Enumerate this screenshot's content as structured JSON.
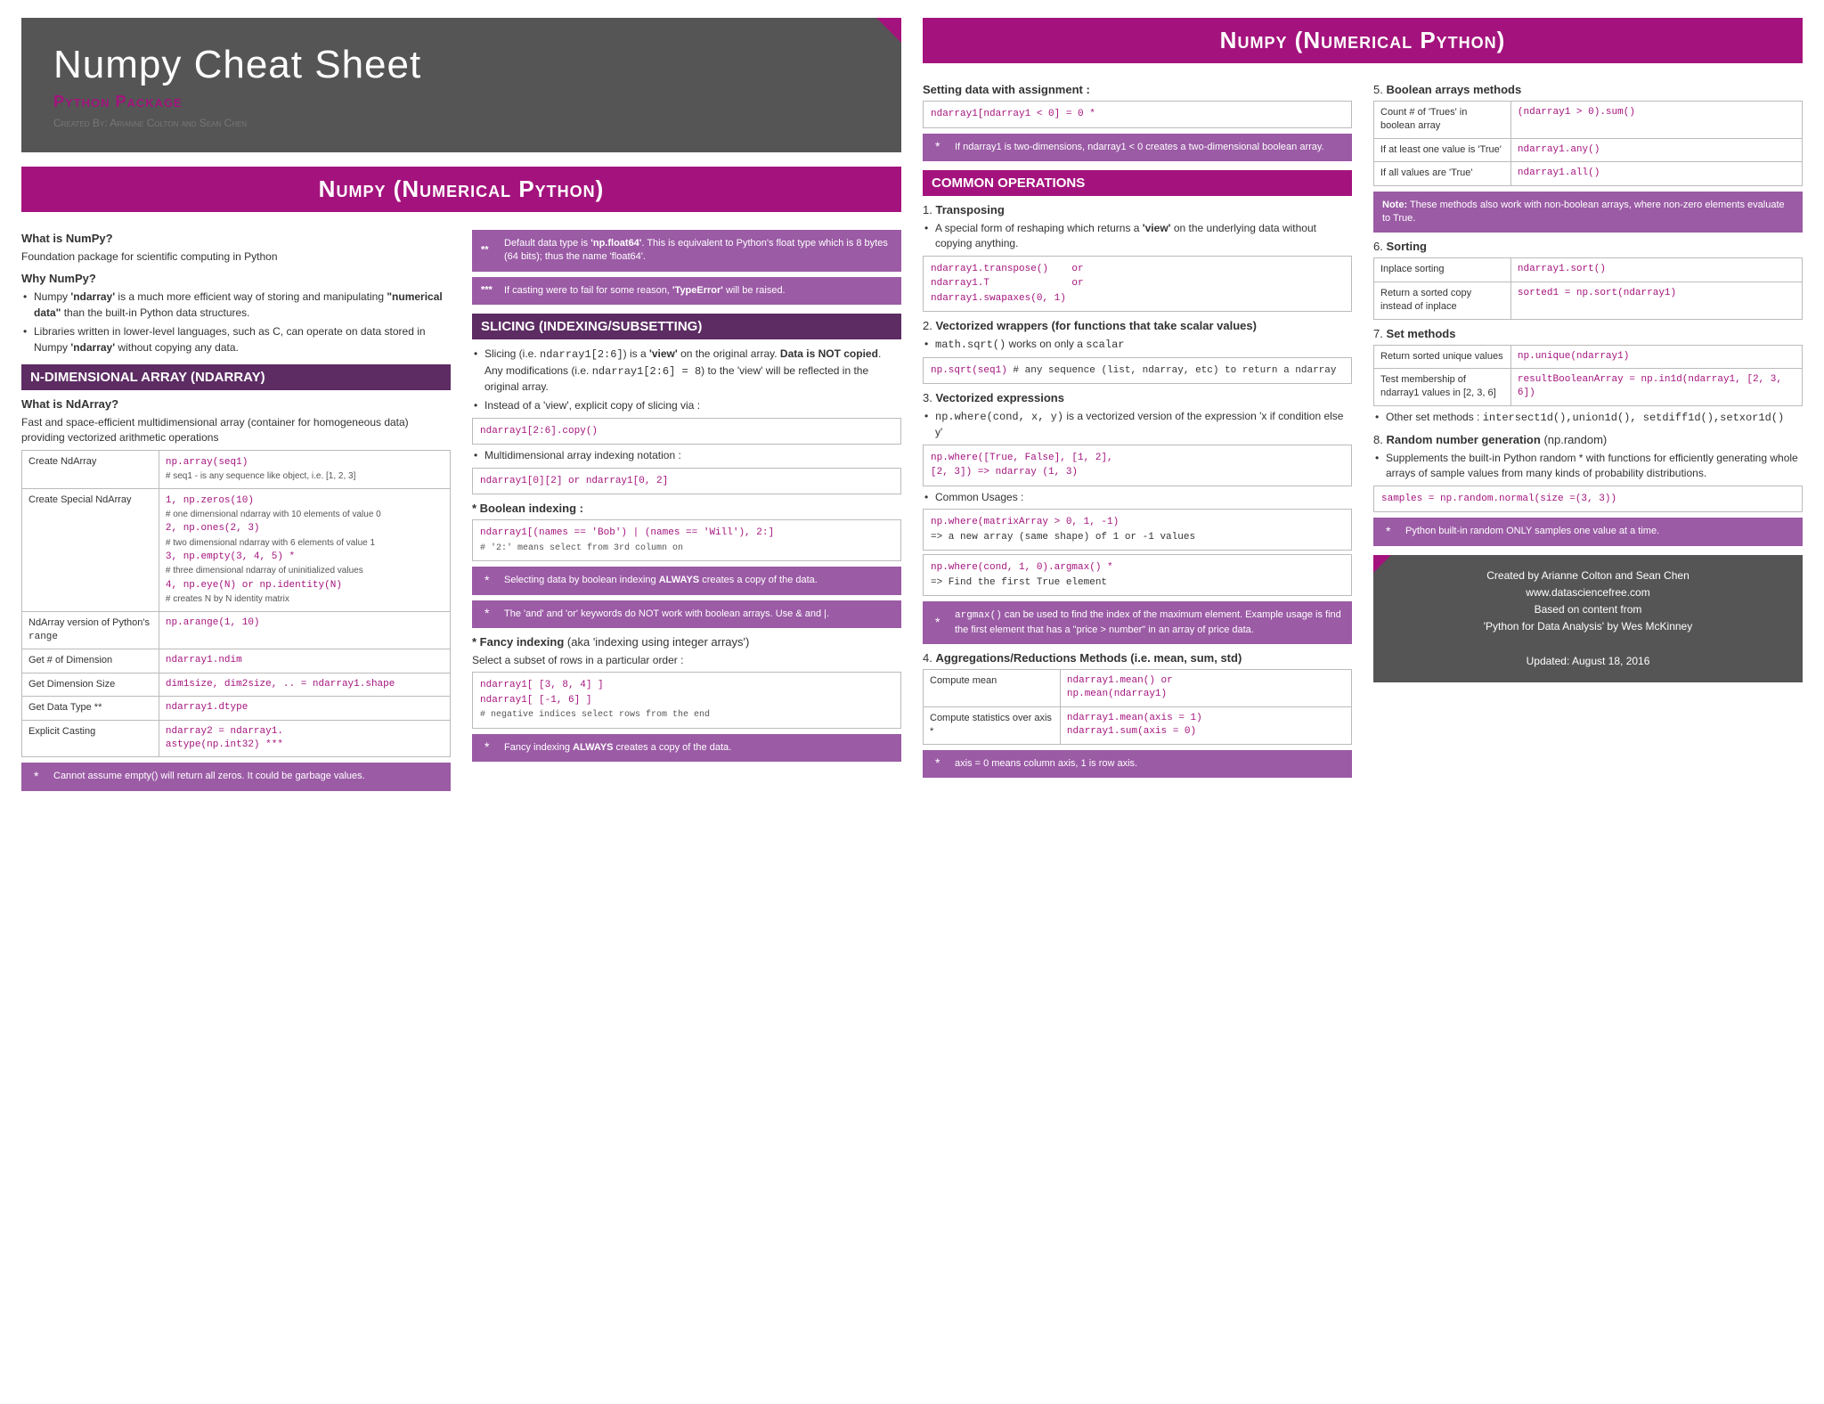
{
  "title": "Numpy Cheat Sheet",
  "subtitle": "Python Package",
  "credit": "Created By: Arianne Colton and Sean Chen",
  "banner_left": "Numpy (Numerical Python)",
  "banner_right": "Numpy (Numerical Python)",
  "c1": {
    "h_what": "What is NumPy?",
    "p_what": "Foundation package for scientific computing in Python",
    "h_why": "Why NumPy?",
    "why1_a": "Numpy ",
    "why1_b": "'ndarray'",
    "why1_c": " is a much more efficient way of storing and manipulating ",
    "why1_d": "\"numerical data\"",
    "why1_e": " than the built-in Python data structures.",
    "why2_a": "Libraries written in lower-level languages, such as C, can operate on data stored in Numpy ",
    "why2_b": "'ndarray'",
    "why2_c": " without copying any data.",
    "sub_nd": "N-DIMENSIONAL ARRAY (NDARRAY)",
    "h_nd": "What is NdArray?",
    "p_nd": "Fast and space-efficient multidimensional array (container for homogeneous data) providing vectorized arithmetic operations",
    "r1l": "Create NdArray",
    "r1c": "np.array(seq1)",
    "r1n": "# seq1 - is any sequence like object, i.e. [1, 2, 3]",
    "r2l": "Create Special NdArray",
    "r2a": "1, np.zeros(10)",
    "r2an": "# one dimensional ndarray with 10 elements of value 0",
    "r2b": "2, np.ones(2, 3)",
    "r2bn": "# two dimensional ndarray with 6 elements of value 1",
    "r2c": "3, np.empty(3, 4, 5) *",
    "r2cn": "# three dimensional ndarray of uninitialized values",
    "r2d": "4, np.eye(N) or np.identity(N)",
    "r2dn": "# creates N by N identity matrix",
    "r3l": "NdArray version of Python's ",
    "r3l2": "range",
    "r3c": "np.arange(1, 10)",
    "r4l": "Get # of Dimension",
    "r4c": "ndarray1.ndim",
    "r5l": "Get Dimension Size",
    "r5c": "dim1size, dim2size, .. = ndarray1.shape",
    "r6l": "Get Data Type **",
    "r6c": "ndarray1.dtype",
    "r7l": "Explicit Casting",
    "r7c": "ndarray2 = ndarray1.\nastype(np.int32) ***",
    "tip1": "Cannot assume empty() will return all zeros. It could be garbage values."
  },
  "c2": {
    "tip_a": "Default data type is ",
    "tip_ab": "'np.float64'",
    "tip_ac": ". This is equivalent to Python's float type which is 8 bytes (64 bits); thus the name 'float64'.",
    "tip_b": "If casting were to fail for some reason, ",
    "tip_bb": "'TypeError'",
    "tip_bc": " will be raised.",
    "sub": "SLICING (INDEXING/SUBSETTING)",
    "s1a": "Slicing (i.e. ",
    "s1b": "ndarray1[2:6]",
    "s1c": ") is a ",
    "s1d": "'view'",
    "s1e": " on the original array. ",
    "s1f": "Data is NOT copied",
    "s1g": ". Any modifications (i.e. ",
    "s1h": "ndarray1[2:6] = 8",
    "s1i": ") to the 'view' will be reflected in the original array.",
    "s2": "Instead of a 'view', explicit copy of slicing via :",
    "cb1": "ndarray1[2:6].copy()",
    "s3": "Multidimensional array indexing notation :",
    "cb2": "ndarray1[0][2] or ndarray1[0, 2]",
    "h_bool": "* Boolean indexing :",
    "cb3": "ndarray1[(names == 'Bob') | (names == 'Will'), 2:]",
    "cb3n": "# '2:' means select from 3rd column on",
    "tip_c1": "Selecting data by boolean indexing ",
    "tip_c2": "ALWAYS",
    "tip_c3": " creates a copy of the data.",
    "tip_d": "The 'and' and 'or' keywords do NOT work with boolean arrays. Use & and |.",
    "h_fancy": "* Fancy indexing",
    "h_fancy2": " (aka 'indexing using integer arrays')",
    "p_fancy": "Select a subset of rows in a particular order :",
    "cb4a": "ndarray1[ [3, 8, 4] ]",
    "cb4b": "ndarray1[ [-1, 6] ]",
    "cb4n": "# negative indices select rows from the end",
    "tip_e1": "Fancy indexing ",
    "tip_e2": "ALWAYS",
    "tip_e3": " creates a copy of the data."
  },
  "c3": {
    "h_set": "Setting data with assignment :",
    "cb1": "ndarray1[ndarray1 < 0] = 0 *",
    "tip1": "If ndarray1 is two-dimensions, ndarray1 < 0 creates a two-dimensional boolean array.",
    "sub": "COMMON OPERATIONS",
    "n1": "1.",
    "t1": "Transposing",
    "p1a": "A special form of reshaping which returns a ",
    "p1b": "'view'",
    "p1c": " on the underlying data without copying anything.",
    "cb_t": "ndarray1.transpose()    or\nndarray1.T              or\nndarray1.swapaxes(0, 1)",
    "n2": "2.",
    "t2": "Vectorized wrappers (for functions that take scalar values)",
    "p2a": "math.sqrt()",
    "p2b": " works on only a ",
    "p2c": "scalar",
    "cb2a": "np.sqrt(seq1)",
    "cb2b": " # any sequence (list, ndarray, etc) to return a ndarray",
    "n3": "3.",
    "t3": "Vectorized expressions",
    "p3a": "np.where(cond, x, y)",
    "p3b": " is a vectorized version of the expression 'x if condition else y'",
    "cb3": "np.where([True, False], [1, 2],\n[2, 3]) => ndarray (1, 3)",
    "p_cu": "Common Usages :",
    "cb4a": "np.where(matrixArray > 0, 1, -1)",
    "cb4an": "=> a new array (same shape) of 1 or -1 values",
    "cb4b": "np.where(cond, 1, 0).argmax() *",
    "cb4bn": "=> Find the first True element",
    "tip_arg1": "argmax()",
    "tip_arg2": " can be used to find the index of the maximum element. Example usage is find the first element that has a \"price > number\" in an array of price data.",
    "n4": "4.",
    "t4": "Aggregations/Reductions Methods (i.e. mean, sum, std)",
    "r1l": "Compute mean",
    "r1c": "ndarray1.mean()   or\nnp.mean(ndarray1)",
    "r2l": "Compute statistics over axis *",
    "r2c": "ndarray1.mean(axis = 1)\nndarray1.sum(axis = 0)",
    "tip_ax": "axis = 0 means column axis, 1 is row axis."
  },
  "c4": {
    "n5": "5.",
    "t5": "Boolean arrays methods",
    "r1l": "Count # of 'Trues' in boolean array",
    "r1c": "(ndarray1 > 0).sum()",
    "r2l": "If at least one value is 'True'",
    "r2c": "ndarray1.any()",
    "r3l": "If all values are 'True'",
    "r3c": "ndarray1.all()",
    "note5a": "Note:",
    "note5b": " These methods also work with non-boolean arrays, where non-zero elements evaluate to True.",
    "n6": "6.",
    "t6": "Sorting",
    "s1l": "Inplace sorting",
    "s1c": "ndarray1.sort()",
    "s2l": "Return a sorted copy instead of inplace",
    "s2c": "sorted1 = np.sort(ndarray1)",
    "n7": "7.",
    "t7": "Set methods",
    "m1l": "Return sorted unique values",
    "m1c": "np.unique(ndarray1)",
    "m2l": "Test membership of ndarray1 values in [2, 3, 6]",
    "m2c": "resultBooleanArray = np.in1d(ndarray1, [2, 3, 6])",
    "other": "Other set methods : ",
    "otherc": "intersect1d(),union1d(), setdiff1d(),setxor1d()",
    "n8": "8.",
    "t8": "Random number generation",
    "t8b": " (np.random)",
    "p8": "Supplements the built-in Python random * with functions for efficiently generating whole arrays of sample values from many kinds of probability distributions.",
    "cb8": "samples = np.random.normal(size =(3, 3))",
    "tip8": "Python built-in random ONLY samples one value at a time."
  },
  "footer": {
    "l1": "Created by Arianne Colton and Sean Chen",
    "l2": "www.datasciencefree.com",
    "l3": "Based on content from",
    "l4": "'Python for Data Analysis' by Wes McKinney",
    "l5": "Updated: August 18, 2016"
  }
}
